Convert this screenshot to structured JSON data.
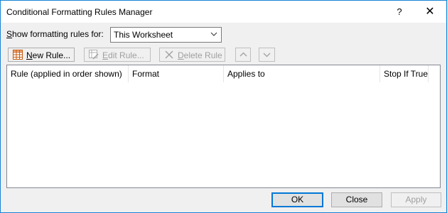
{
  "window": {
    "title": "Conditional Formatting Rules Manager",
    "help_glyph": "?",
    "close_glyph": "✕"
  },
  "scope": {
    "label_prefix": "",
    "label_accel": "S",
    "label_rest": "how formatting rules for:",
    "selected": "This Worksheet"
  },
  "toolbar": {
    "new_accel": "N",
    "new_rest": "ew Rule...",
    "edit_accel": "E",
    "edit_rest": "dit Rule...",
    "delete_accel": "D",
    "delete_rest": "elete Rule"
  },
  "rules_table": {
    "columns": [
      "Rule (applied in order shown)",
      "Format",
      "Applies to",
      "Stop If True"
    ],
    "rows": []
  },
  "buttons": {
    "ok": "OK",
    "close": "Close",
    "apply": "Apply"
  }
}
